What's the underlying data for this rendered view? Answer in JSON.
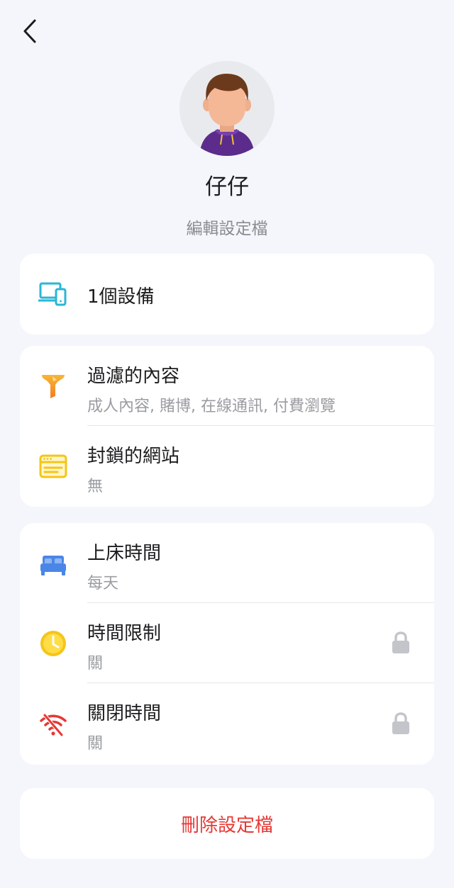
{
  "profile": {
    "name": "仔仔",
    "edit_label": "編輯設定檔"
  },
  "devices": {
    "label": "1個設備",
    "icon": "devices-icon",
    "icon_color": "#29b6d6"
  },
  "content_section": {
    "filtered": {
      "title": "過濾的內容",
      "subtitle": "成人內容, 賭博, 在線通訊, 付費瀏覽",
      "icon": "filter-icon",
      "icon_color": "#f57c20"
    },
    "blocked": {
      "title": "封鎖的網站",
      "subtitle": "無",
      "icon": "browser-window-icon",
      "icon_color": "#f5c518"
    }
  },
  "time_section": {
    "bedtime": {
      "title": "上床時間",
      "subtitle": "每天",
      "icon": "bed-icon",
      "icon_color": "#4a86e8"
    },
    "time_limit": {
      "title": "時間限制",
      "subtitle": "關",
      "icon": "clock-icon",
      "icon_color": "#f5c518",
      "locked": true
    },
    "offtime": {
      "title": "關閉時間",
      "subtitle": "關",
      "icon": "wifi-off-icon",
      "icon_color": "#e53935",
      "locked": true
    }
  },
  "delete": {
    "label": "刪除設定檔",
    "color": "#e53935"
  },
  "colors": {
    "background": "#f4f6fb",
    "card": "#ffffff",
    "lock": "#c4c5ca"
  }
}
